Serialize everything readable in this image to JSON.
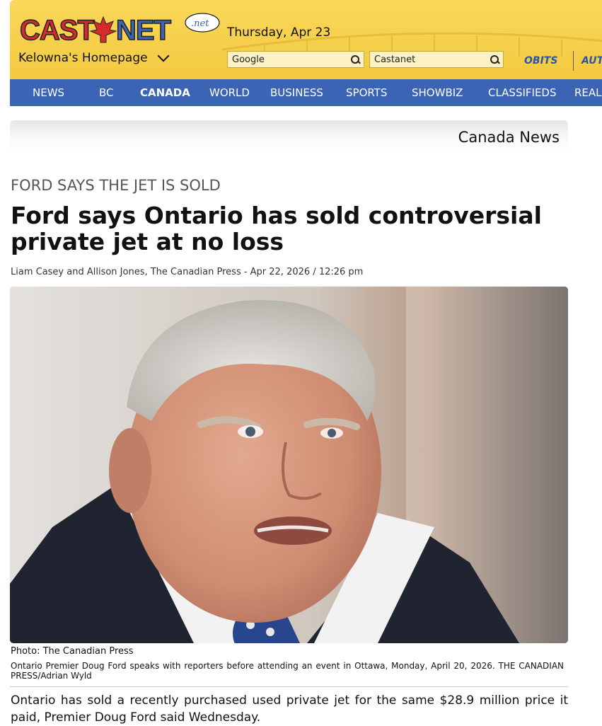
{
  "header": {
    "logo_text": "CASTANET",
    "logo_suffix": ".net",
    "location": "Kelowna's Homepage",
    "date": "Thursday, Apr 23",
    "search_google_placeholder": "Google",
    "search_castanet_placeholder": "Castanet",
    "obits": "OBITS",
    "auto": "AUT"
  },
  "nav": {
    "items": [
      {
        "label": "NEWS"
      },
      {
        "label": "BC"
      },
      {
        "label": "CANADA"
      },
      {
        "label": "WORLD"
      },
      {
        "label": "BUSINESS"
      },
      {
        "label": "SPORTS"
      },
      {
        "label": "SHOWBIZ"
      },
      {
        "label": "CLASSIFIEDS"
      },
      {
        "label": "REAL"
      }
    ],
    "active": "CANADA"
  },
  "section": {
    "title": "Canada News"
  },
  "article": {
    "kicker": "FORD SAYS THE JET IS SOLD",
    "headline": "Ford says Ontario has sold controversial private jet at no loss",
    "byline": "Liam Casey and Allison Jones, The Canadian Press - Apr 22, 2026 / 12:26 pm",
    "photo_credit": "Photo: The Canadian Press",
    "caption": "Ontario Premier Doug Ford speaks with reporters before attending an event in Ottawa, Monday, April 20, 2026. THE CANADIAN PRESS/Adrian Wyld",
    "body": "Ontario has sold a recently purchased used private jet for the same $28.9 million price it paid, Premier Doug Ford said Wednesday."
  },
  "colors": {
    "header_yellow": "#f3c940",
    "nav_blue": "#3b64b5",
    "link_blue": "#2b56a6",
    "logo_red": "#d62b2b"
  }
}
